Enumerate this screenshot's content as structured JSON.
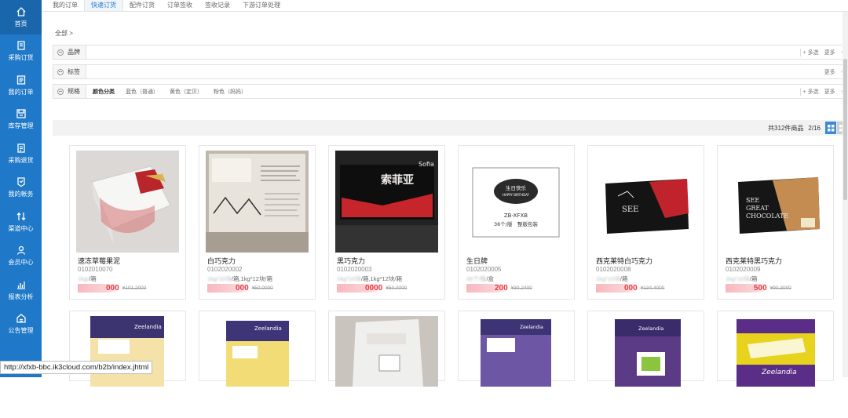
{
  "sidebar": [
    {
      "label": "首页",
      "icon": "home-icon"
    },
    {
      "label": "采购订货",
      "icon": "purchase-order-icon"
    },
    {
      "label": "我的订单",
      "icon": "orders-icon"
    },
    {
      "label": "库存管理",
      "icon": "inventory-icon"
    },
    {
      "label": "采购退货",
      "icon": "return-icon"
    },
    {
      "label": "我的帐务",
      "icon": "account-icon"
    },
    {
      "label": "渠道中心",
      "icon": "channel-icon"
    },
    {
      "label": "会员中心",
      "icon": "member-icon"
    },
    {
      "label": "报表分析",
      "icon": "report-icon"
    },
    {
      "label": "公告管理",
      "icon": "notice-icon"
    }
  ],
  "tabs": [
    "我的订单",
    "快速订货",
    "配件订货",
    "订单签收",
    "签收记录",
    "下游订单处理"
  ],
  "breadcrumb": "全部 >",
  "filters": {
    "brand": {
      "label": "品牌",
      "multi": "+ 多选",
      "more": "更多"
    },
    "tag": {
      "label": "标签",
      "more": "更多"
    },
    "spec": {
      "label": "规格",
      "options": [
        "颜色分类",
        "蓝色（普通）",
        "黄色（定贝）",
        "粉色（妈妈）"
      ],
      "multi": "+ 多选",
      "more": "更多"
    }
  },
  "toolbar": {
    "total": "共312件商品",
    "page": "2/16"
  },
  "products": [
    {
      "name": "速冻草莓果泥",
      "code": "0102010070",
      "spec_visible": "/箱",
      "price_visible": "000",
      "old_price": "¥101.2000"
    },
    {
      "name": "白巧克力",
      "code": "0102020002",
      "spec_visible": "/箱,1kg*12块/箱",
      "price_visible": "000",
      "old_price": "¥50.0000"
    },
    {
      "name": "黑巧克力",
      "code": "0102020003",
      "spec_visible": "/箱,1kg*12块/箱",
      "price_visible": "0000",
      "old_price": "¥50.0000"
    },
    {
      "name": "生日牌",
      "code": "0102020005",
      "spec_visible": "/盒",
      "price_visible": "200",
      "old_price": "¥30.2400"
    },
    {
      "name": "西克莱特白巧克力",
      "code": "0102020008",
      "spec_visible": "/箱",
      "price_visible": "000",
      "old_price": "¥134.4000"
    },
    {
      "name": "西克莱特黑巧克力",
      "code": "0102020009",
      "spec_visible": "/箱",
      "price_visible": "500",
      "old_price": "¥90.3000"
    }
  ],
  "row2_labels": [
    "Zeelandia",
    "Zeelandia",
    "Zeelandia",
    "Zeelandia"
  ],
  "thumb_texts": {
    "chocolate_black": "索菲亚",
    "chocolate_black_sub": "Sofia",
    "birthday_badge": "生日快乐",
    "birthday_badge_en": "HAPPY BIRTHDAY",
    "birthday_code": "ZB-XFXB",
    "birthday_desc": "36个/版　整版包装",
    "see_white": "SEE",
    "see_black_1": "SEE",
    "see_black_2": "GREAT",
    "see_black_3": "CHOCOLATE"
  },
  "status_url": "http://xfxb-bbc.ik3cloud.com/b2b/index.jhtml"
}
